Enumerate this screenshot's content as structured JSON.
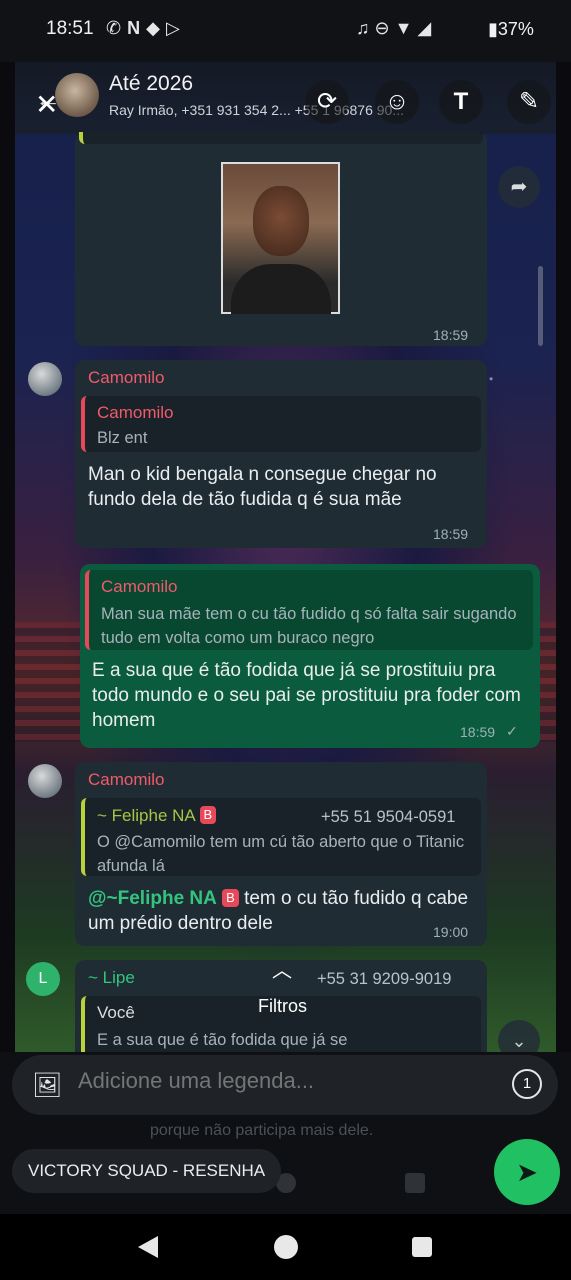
{
  "status_bar": {
    "time": "18:51",
    "left_icons": [
      "whatsapp-icon",
      "n-icon",
      "android-icon",
      "play-store-icon"
    ],
    "right_icons": [
      "headphones-icon",
      "dnd-icon",
      "wifi-icon",
      "signal-icon"
    ],
    "battery": "37%"
  },
  "header": {
    "title": "Até 2026",
    "subtitle": "Ray Irmão, +351 931 354 2... +55 1 96876 90...",
    "tools": [
      "crop-rotate-icon",
      "sticker-icon",
      "text-icon",
      "pencil-icon"
    ]
  },
  "messages": [
    {
      "id": "m1",
      "type": "image-reply",
      "quote_text_partial": "o Titanic afunda lá",
      "time": "18:59"
    },
    {
      "id": "m2",
      "sender": "Camomilo",
      "quote_name": "Camomilo",
      "quote_text": "Blz ent",
      "text": "Man o kid bengala n consegue chegar no fundo dela de tão fudida q é sua mãe",
      "time": "18:59"
    },
    {
      "id": "m3",
      "outgoing": true,
      "quote_name": "Camomilo",
      "quote_text": "Man sua mãe tem o cu tão fudido q só falta sair sugando tudo em volta como um buraco negro",
      "text": "E a sua que é tão fodida que já se  prostituiu pra todo mundo e o seu pai se prostituiu pra foder com homem",
      "time": "18:59",
      "status": "✓"
    },
    {
      "id": "m4",
      "sender": "Camomilo",
      "quote_name": "~ Feliphe NA",
      "quote_badge": "B",
      "quote_phone": "+55 51 9504-0591",
      "quote_text": "O @Camomilo tem um cú tão aberto que o Titanic afunda lá",
      "mention": "@~Feliphe NA",
      "mention_badge": "B",
      "text": " tem o cu tão fudido q cabe um prédio dentro dele",
      "time": "19:00"
    },
    {
      "id": "m5",
      "sender": "~ Lipe",
      "sender_phone": "+55 31 9209-9019",
      "avatar_letter": "L",
      "quote_name": "Você",
      "quote_text": "E a sua que é tão fodida que já se"
    }
  ],
  "filters_label": "Filtros",
  "caption": {
    "placeholder": "Adicione uma legenda...",
    "view_once": "1"
  },
  "ghost_text": "porque não participa mais dele.",
  "recipient": "VICTORY SQUAD - RESENHA",
  "colors": {
    "incoming_bubble": "#1f2c34",
    "outgoing_bubble": "#0b5c3e",
    "sender_name": "#f05a6b",
    "mention": "#33c57e",
    "send_button": "#21c063"
  }
}
